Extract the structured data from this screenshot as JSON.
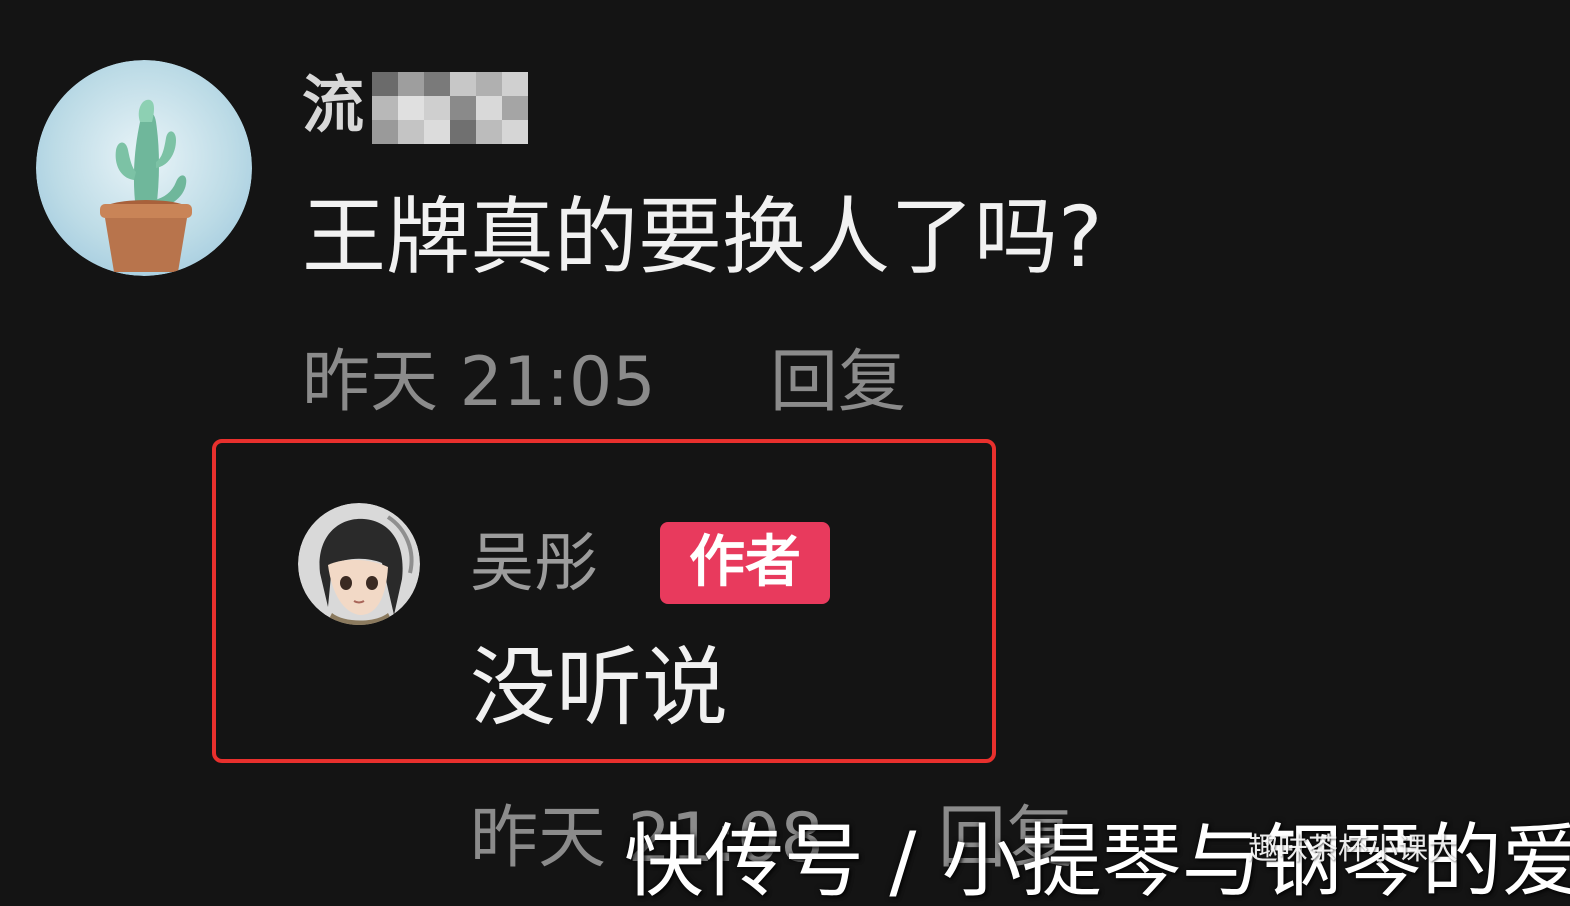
{
  "comment": {
    "username_visible_char": "流",
    "text": "王牌真的要换人了吗?",
    "time": "昨天 21:05",
    "reply_label": "回复"
  },
  "author_reply": {
    "name": "吴彤",
    "badge": "作者",
    "text": "没听说",
    "time": "昨天 21:08",
    "reply_label": "回复"
  },
  "watermark": {
    "main": "快传号 / 小提琴与钢琴的爱",
    "small": "趣味茶杯小课大"
  },
  "colors": {
    "background": "#141414",
    "highlight_border": "#e8302d",
    "author_badge": "#e83a5d"
  }
}
